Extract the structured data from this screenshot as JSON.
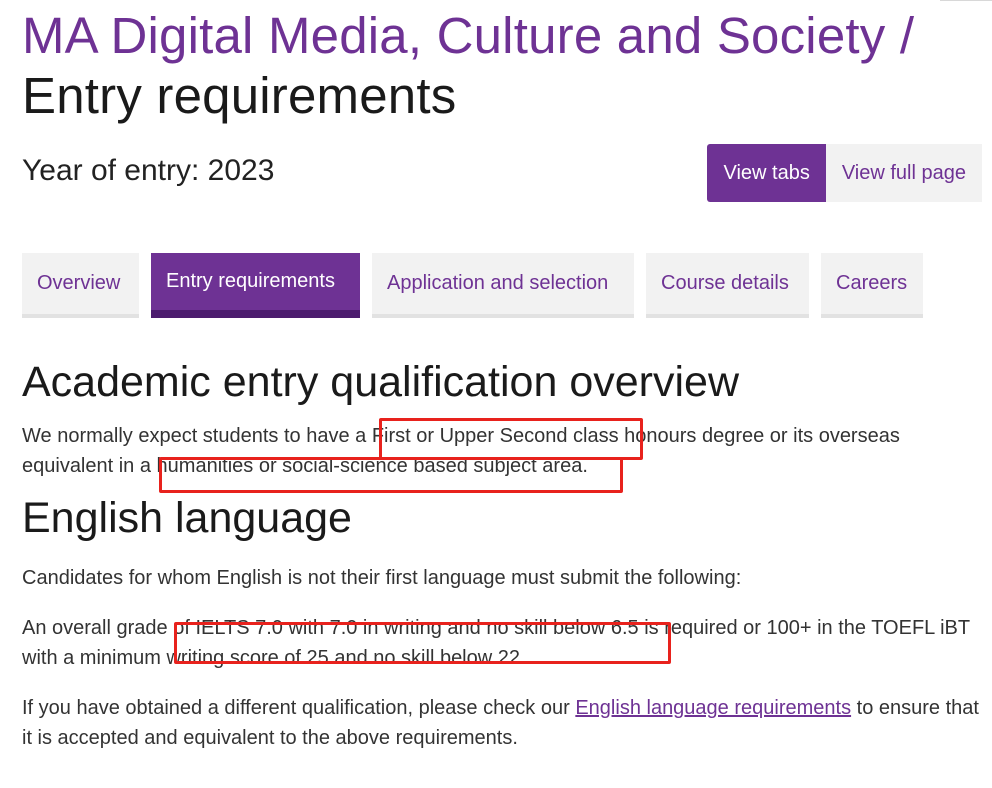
{
  "header": {
    "programme": "MA Digital Media, Culture and Society /",
    "subtitle": "Entry requirements"
  },
  "year_of_entry": "Year of entry: 2023",
  "view_switch": {
    "tabs_label": "View tabs",
    "full_label": "View full page"
  },
  "tabs": [
    {
      "label": "Overview"
    },
    {
      "label": "Entry requirements"
    },
    {
      "label": "Application and selection"
    },
    {
      "label": "Course details"
    },
    {
      "label": "Careers"
    }
  ],
  "sections": {
    "academic": {
      "heading": "Academic entry qualification overview",
      "p1": "We normally expect students to have a First or Upper Second class honours degree or its overseas equivalent in a humanities or social-science based subject area."
    },
    "english": {
      "heading": "English language",
      "p1": "Candidates for whom English is not their first language must submit the following:",
      "p2": "An overall grade of IELTS 7.0 with 7.0 in writing and no skill below 6.5 is required or 100+ in the TOEFL iBT with a minimum writing score of 25 and no skill below 22.",
      "p3_before": "If you have obtained a different qualification, please check our ",
      "p3_link": "English language requirements",
      "p3_after": " to ensure that it is accepted and equivalent to the above requirements."
    }
  },
  "colors": {
    "brand_purple": "#6e3294",
    "annotation_red": "#e8221d"
  }
}
